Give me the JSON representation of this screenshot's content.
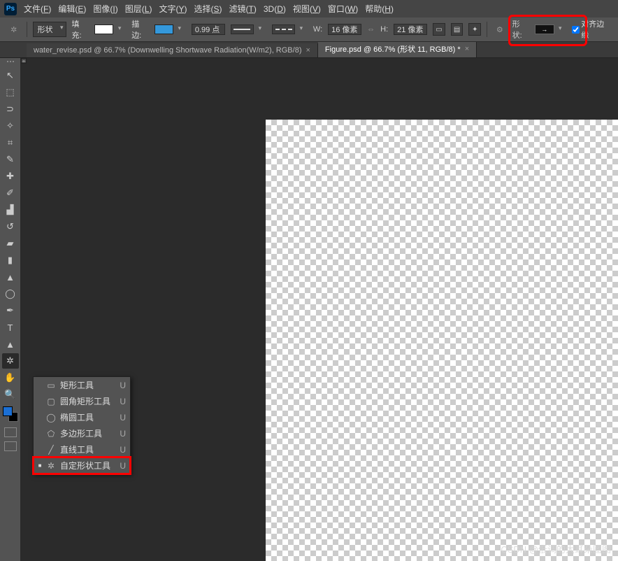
{
  "app": {
    "logo": "Ps"
  },
  "menu": [
    {
      "label": "文件",
      "key": "F"
    },
    {
      "label": "编辑",
      "key": "E"
    },
    {
      "label": "图像",
      "key": "I"
    },
    {
      "label": "图层",
      "key": "L"
    },
    {
      "label": "文字",
      "key": "Y"
    },
    {
      "label": "选择",
      "key": "S"
    },
    {
      "label": "滤镜",
      "key": "T"
    },
    {
      "label": "3D",
      "key": "D"
    },
    {
      "label": "视图",
      "key": "V"
    },
    {
      "label": "窗口",
      "key": "W"
    },
    {
      "label": "帮助",
      "key": "H"
    }
  ],
  "options": {
    "mode_label": "形状",
    "fill_label": "填充:",
    "stroke_label": "描边:",
    "stroke_width": "0.99 点",
    "w_label": "W:",
    "w_value": "16 像素",
    "h_label": "H:",
    "h_value": "21 像素",
    "shape_label": "形状:",
    "align_edges": "对齐边缘"
  },
  "tabs": [
    {
      "title": "water_revise.psd @ 66.7% (Downwelling Shortwave Radiation(W/m2), RGB/8)",
      "active": false
    },
    {
      "title": "Figure.psd @ 66.7% (形状 11, RGB/8) *",
      "active": true
    }
  ],
  "tools": [
    {
      "name": "move-tool",
      "glyph": "↖"
    },
    {
      "name": "marquee-tool",
      "glyph": "⬚"
    },
    {
      "name": "lasso-tool",
      "glyph": "⊃"
    },
    {
      "name": "magic-wand-tool",
      "glyph": "✧"
    },
    {
      "name": "crop-tool",
      "glyph": "⌗"
    },
    {
      "name": "eyedropper-tool",
      "glyph": "✎"
    },
    {
      "name": "healing-brush-tool",
      "glyph": "✚"
    },
    {
      "name": "brush-tool",
      "glyph": "✐"
    },
    {
      "name": "clone-stamp-tool",
      "glyph": "▟"
    },
    {
      "name": "history-brush-tool",
      "glyph": "↺"
    },
    {
      "name": "eraser-tool",
      "glyph": "▰"
    },
    {
      "name": "gradient-tool",
      "glyph": "▮"
    },
    {
      "name": "blur-tool",
      "glyph": "▲"
    },
    {
      "name": "dodge-tool",
      "glyph": "◯"
    },
    {
      "name": "pen-tool",
      "glyph": "✒"
    },
    {
      "name": "type-tool",
      "glyph": "T"
    },
    {
      "name": "path-selection-tool",
      "glyph": "▲"
    },
    {
      "name": "custom-shape-tool",
      "glyph": "✲",
      "active": true
    },
    {
      "name": "hand-tool",
      "glyph": "✋"
    },
    {
      "name": "zoom-tool",
      "glyph": "🔍"
    }
  ],
  "flyout": [
    {
      "label": "矩形工具",
      "key": "U",
      "icon": "▭",
      "active": false
    },
    {
      "label": "圆角矩形工具",
      "key": "U",
      "icon": "▢",
      "active": false
    },
    {
      "label": "椭圆工具",
      "key": "U",
      "icon": "◯",
      "active": false
    },
    {
      "label": "多边形工具",
      "key": "U",
      "icon": "⬠",
      "active": false
    },
    {
      "label": "直线工具",
      "key": "U",
      "icon": "╱",
      "active": false
    },
    {
      "label": "自定形状工具",
      "key": "U",
      "icon": "✲",
      "active": true
    }
  ],
  "watermark": "CSDN @低调的大耳朵图图"
}
